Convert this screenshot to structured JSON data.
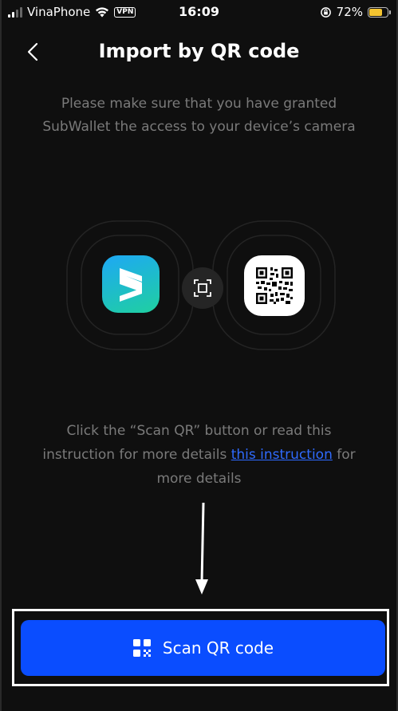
{
  "status_bar": {
    "carrier": "VinaPhone",
    "vpn_label": "VPN",
    "time": "16:09",
    "battery_percent": "72%",
    "battery_level": 0.72,
    "icons": [
      "signal-icon",
      "wifi-icon",
      "vpn-icon",
      "orientation-lock-icon",
      "battery-icon"
    ]
  },
  "header": {
    "title": "Import by QR code",
    "back_icon": "chevron-left-icon"
  },
  "instruction": {
    "line1": "Please make sure that you have granted",
    "line2": "SubWallet the access to your device’s camera"
  },
  "illustration": {
    "left_icon": "subwallet-logo-icon",
    "middle_icon": "scan-frame-icon",
    "right_icon": "qr-code-icon"
  },
  "help": {
    "text_before": "Click the “Scan QR” button or read this instruction for more details ",
    "link_text": "this instruction",
    "text_after": " for more details"
  },
  "primary_button": {
    "label": "Scan QR code",
    "icon": "qr-scan-icon"
  },
  "colors": {
    "background": "#0f0f0f",
    "accent": "#0a4dff",
    "link": "#2f6bff",
    "muted_text": "#7a7a7a",
    "battery": "#f4c430"
  }
}
